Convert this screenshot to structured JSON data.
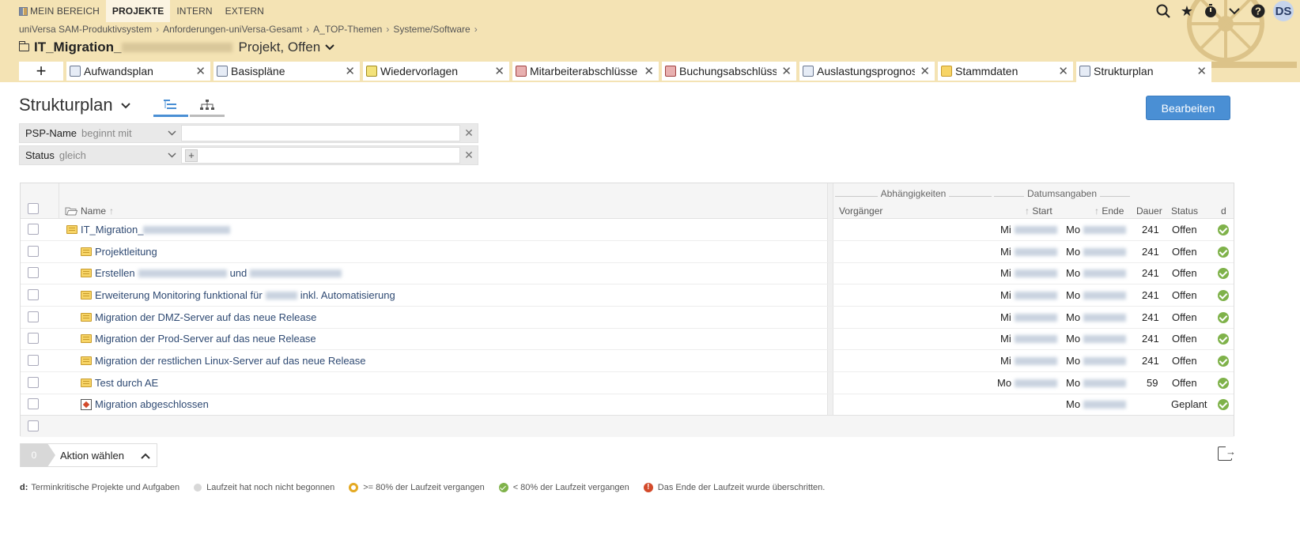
{
  "topnav": {
    "items": [
      {
        "label": "MEIN BEREICH",
        "active": false
      },
      {
        "label": "PROJEKTE",
        "active": true
      },
      {
        "label": "INTERN",
        "active": false
      },
      {
        "label": "EXTERN",
        "active": false
      }
    ]
  },
  "user": {
    "initials": "DS"
  },
  "breadcrumb": [
    "uniVersa SAM-Produktivsystem",
    "Anforderungen-uniVersa-Gesamt",
    "A_TOP-Themen",
    "Systeme/Software"
  ],
  "project": {
    "name_prefix": "IT_Migration_",
    "status": "Projekt, Offen"
  },
  "tabs": [
    {
      "label": "Aufwandsplan",
      "icon": "clock-icon"
    },
    {
      "label": "Basispläne",
      "icon": "camera-icon"
    },
    {
      "label": "Wiedervorlagen",
      "icon": "return-icon"
    },
    {
      "label": "Mitarbeiterabschlüsse",
      "icon": "lock-icon"
    },
    {
      "label": "Buchungsabschlüsse",
      "icon": "lock-icon"
    },
    {
      "label": "Auslastungsprognose",
      "icon": "forecast-icon"
    },
    {
      "label": "Stammdaten",
      "icon": "folder-icon"
    },
    {
      "label": "Strukturplan",
      "icon": "tree-icon",
      "active": true
    }
  ],
  "page": {
    "title": "Strukturplan",
    "edit_label": "Bearbeiten"
  },
  "filters": [
    {
      "field": "PSP-Name",
      "operator": "beginnt mit",
      "value": ""
    },
    {
      "field": "Status",
      "operator": "gleich",
      "value": ""
    }
  ],
  "table": {
    "groups": {
      "dependencies": "Abhängigkeiten",
      "dates": "Datumsangaben"
    },
    "columns": {
      "name": "Name",
      "predecessor": "Vorgänger",
      "start": "Start",
      "end": "Ende",
      "duration": "Dauer",
      "status": "Status",
      "d": "d"
    },
    "rows": [
      {
        "name": "IT_Migration_",
        "level": 0,
        "icon": "folder-open-icon",
        "start_day": "Mi",
        "end_day": "Mo",
        "duration": "241",
        "status": "Offen"
      },
      {
        "name": "Projektleitung",
        "level": 1,
        "icon": "folder-icon",
        "start_day": "Mi",
        "end_day": "Mo",
        "duration": "241",
        "status": "Offen"
      },
      {
        "name": "Erstellen",
        "name_mid": "und",
        "level": 1,
        "icon": "folder-icon",
        "start_day": "Mi",
        "end_day": "Mo",
        "duration": "241",
        "status": "Offen"
      },
      {
        "name": "Erweiterung Monitoring funktional für",
        "name_tail": "inkl. Automatisierung",
        "level": 1,
        "icon": "folder-icon",
        "start_day": "Mi",
        "end_day": "Mo",
        "duration": "241",
        "status": "Offen"
      },
      {
        "name": "Migration der DMZ-Server auf das neue Release",
        "level": 1,
        "icon": "folder-icon",
        "start_day": "Mi",
        "end_day": "Mo",
        "duration": "241",
        "status": "Offen"
      },
      {
        "name": "Migration der Prod-Server auf das neue Release",
        "level": 1,
        "icon": "folder-icon",
        "start_day": "Mi",
        "end_day": "Mo",
        "duration": "241",
        "status": "Offen"
      },
      {
        "name": "Migration der restlichen Linux-Server auf das neue Release",
        "level": 1,
        "icon": "folder-icon",
        "start_day": "Mi",
        "end_day": "Mo",
        "duration": "241",
        "status": "Offen"
      },
      {
        "name": "Test durch AE",
        "level": 1,
        "icon": "folder-icon",
        "start_day": "Mo",
        "end_day": "Mo",
        "duration": "59",
        "status": "Offen"
      },
      {
        "name": "Migration abgeschlossen",
        "level": 1,
        "icon": "milestone-icon",
        "start_day": "",
        "end_day": "Mo",
        "duration": "",
        "status": "Geplant"
      }
    ]
  },
  "actions": {
    "count": "0",
    "label": "Aktion wählen"
  },
  "legend": {
    "title": "d:",
    "title_text": "Terminkritische Projekte und Aufgaben",
    "items": [
      "Laufzeit hat noch nicht begonnen",
      ">= 80% der Laufzeit vergangen",
      "< 80% der Laufzeit vergangen",
      "Das Ende der Laufzeit wurde überschritten."
    ]
  },
  "colors": {
    "header_bg": "#f4e3b4",
    "accent": "#4a8fd4",
    "ok": "#7fb24a",
    "warn": "#e4a923",
    "error": "#d34a2a"
  }
}
